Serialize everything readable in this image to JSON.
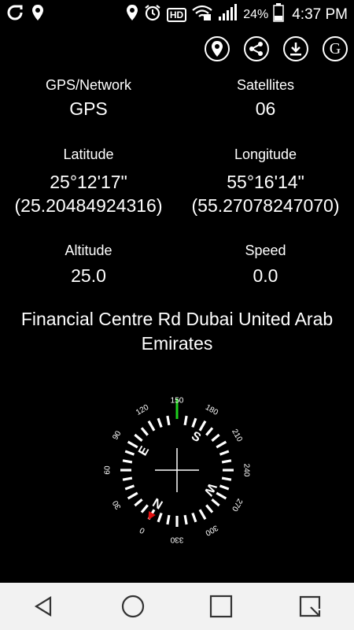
{
  "status_bar": {
    "battery": "24%",
    "time": "4:37 PM",
    "hd_badge": "HD",
    "icons": [
      "app-icon",
      "location-pin-icon",
      "location-pin-icon",
      "alarm-icon",
      "wifi-icon",
      "signal-icon",
      "battery-icon"
    ]
  },
  "toolbar": {
    "icons": [
      "location-icon",
      "share-icon",
      "download-icon",
      "google-icon"
    ],
    "google_letter": "G"
  },
  "info": {
    "gps_network_label": "GPS/Network",
    "gps_network_value": "GPS",
    "satellites_label": "Satellites",
    "satellites_value": "06",
    "latitude_label": "Latitude",
    "latitude_dms": "25°12'17\"",
    "latitude_decimal": "(25.20484924316)",
    "longitude_label": "Longitude",
    "longitude_dms": "55°16'14\"",
    "longitude_decimal": "(55.27078247070)",
    "altitude_label": "Altitude",
    "altitude_value": "25.0",
    "speed_label": "Speed",
    "speed_value": "0.0"
  },
  "address": {
    "line1": "Financial Centre Rd Dubai United Arab",
    "line2": "Emirates"
  },
  "compass": {
    "heading_deg": 150,
    "degree_labels": [
      "0",
      "30",
      "60",
      "90",
      "120",
      "150",
      "180",
      "210",
      "240",
      "270",
      "300",
      "330"
    ],
    "cardinals": [
      "N",
      "E",
      "S",
      "W"
    ],
    "rotation_deg": -150,
    "heading_color": "#1fd01f",
    "north_marker_color": "#e01010"
  },
  "nav_bar": {
    "icons": [
      "back-icon",
      "home-icon",
      "recents-icon",
      "qslide-icon"
    ]
  }
}
